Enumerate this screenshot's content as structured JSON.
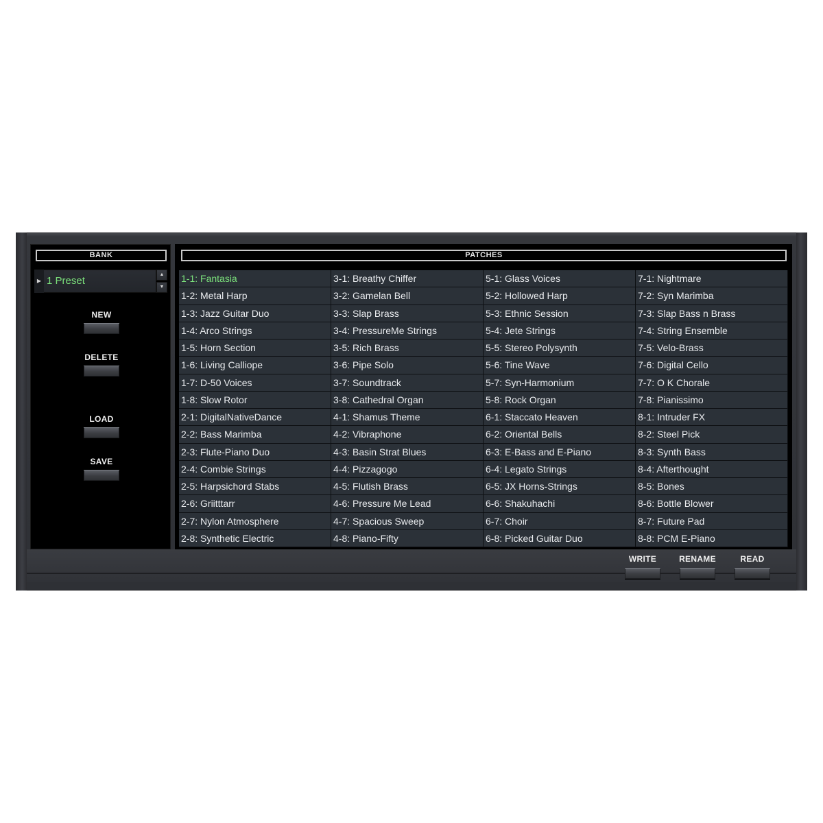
{
  "bank": {
    "title": "BANK",
    "selected": "1 Preset",
    "buttons": {
      "new": "NEW",
      "delete": "DELETE",
      "load": "LOAD",
      "save": "SAVE"
    }
  },
  "patches": {
    "title": "PATCHES",
    "selected_index": 0,
    "columns": [
      [
        "1-1: Fantasia",
        "1-2: Metal Harp",
        "1-3: Jazz Guitar Duo",
        "1-4: Arco Strings",
        "1-5: Horn Section",
        "1-6: Living Calliope",
        "1-7: D-50 Voices",
        "1-8: Slow Rotor",
        "2-1: DigitalNativeDance",
        "2-2: Bass Marimba",
        "2-3: Flute-Piano Duo",
        "2-4: Combie Strings",
        "2-5: Harpsichord Stabs",
        "2-6: Griitttarr",
        "2-7: Nylon Atmosphere",
        "2-8: Synthetic Electric"
      ],
      [
        "3-1: Breathy Chiffer",
        "3-2: Gamelan Bell",
        "3-3: Slap Brass",
        "3-4: PressureMe Strings",
        "3-5: Rich Brass",
        "3-6: Pipe Solo",
        "3-7: Soundtrack",
        "3-8: Cathedral Organ",
        "4-1: Shamus Theme",
        "4-2: Vibraphone",
        "4-3: Basin Strat Blues",
        "4-4: Pizzagogo",
        "4-5: Flutish Brass",
        "4-6: Pressure Me Lead",
        "4-7: Spacious Sweep",
        "4-8: Piano-Fifty"
      ],
      [
        "5-1: Glass Voices",
        "5-2: Hollowed Harp",
        "5-3: Ethnic Session",
        "5-4: Jete Strings",
        "5-5: Stereo Polysynth",
        "5-6: Tine Wave",
        "5-7: Syn-Harmonium",
        "5-8: Rock Organ",
        "6-1: Staccato Heaven",
        "6-2: Oriental Bells",
        "6-3: E-Bass and E-Piano",
        "6-4: Legato Strings",
        "6-5: JX Horns-Strings",
        "6-6: Shakuhachi",
        "6-7: Choir",
        "6-8: Picked Guitar Duo"
      ],
      [
        "7-1: Nightmare",
        "7-2: Syn Marimba",
        "7-3: Slap Bass n Brass",
        "7-4: String Ensemble",
        "7-5: Velo-Brass",
        "7-6: Digital Cello",
        "7-7: O K  Chorale",
        "7-8: Pianissimo",
        "8-1: Intruder FX",
        "8-2: Steel Pick",
        "8-3: Synth Bass",
        "8-4: Afterthought",
        "8-5: Bones",
        "8-6: Bottle Blower",
        "8-7: Future Pad",
        "8-8: PCM E-Piano"
      ]
    ]
  },
  "actions": {
    "write": "WRITE",
    "rename": "RENAME",
    "read": "READ"
  },
  "colors": {
    "selected_text": "#7be07b",
    "cell_background": "#2b3138",
    "panel_background": "#000000"
  }
}
